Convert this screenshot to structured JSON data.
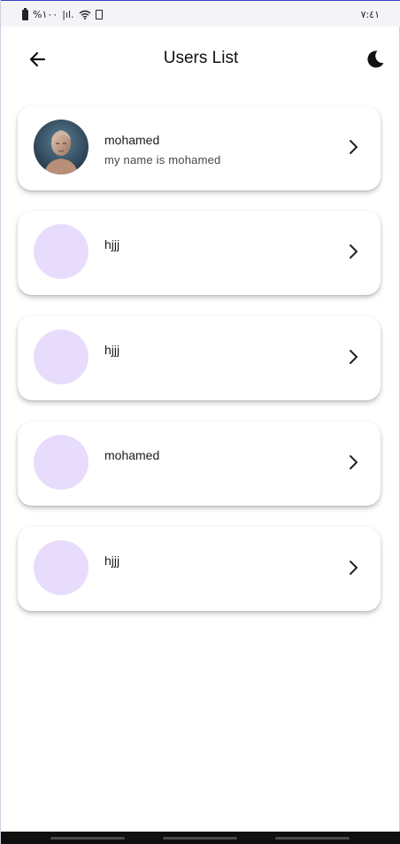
{
  "status_bar": {
    "left_text": "%١٠٠",
    "signal_text": "|ıl.",
    "time": "٧:٤١"
  },
  "app_bar": {
    "title": "Users List",
    "back_icon": "arrow-left-icon",
    "theme_icon": "moon-icon"
  },
  "users": [
    {
      "name": "mohamed",
      "bio": "my name is mohamed",
      "has_photo": true
    },
    {
      "name": "hjjj",
      "bio": "",
      "has_photo": false
    },
    {
      "name": "hjjj",
      "bio": "",
      "has_photo": false
    },
    {
      "name": "mohamed",
      "bio": "",
      "has_photo": false
    },
    {
      "name": "hjjj",
      "bio": "",
      "has_photo": false
    }
  ],
  "colors": {
    "avatar_placeholder": "#e8dcfc",
    "card_background": "#ffffff",
    "text_primary": "#1c1b1f",
    "text_secondary": "#49454f"
  }
}
